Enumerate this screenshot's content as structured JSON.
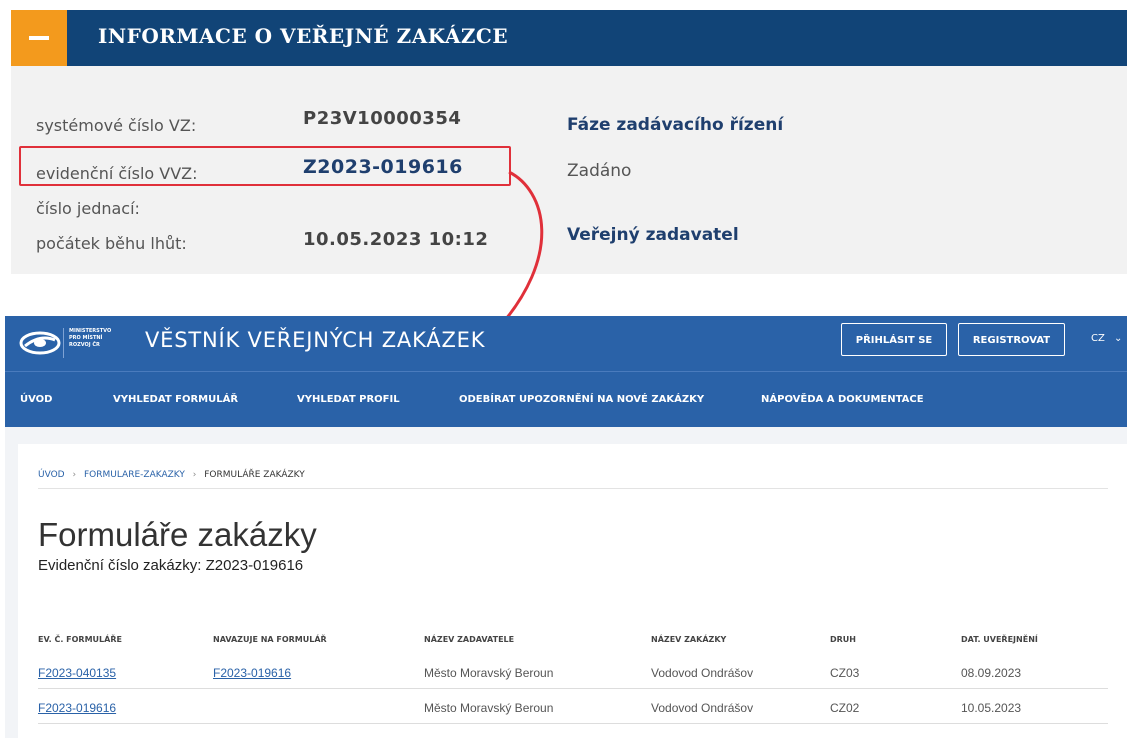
{
  "info_panel": {
    "title": "INFORMACE O VEŘEJNÉ ZAKÁZCE",
    "collapse_symbol": "minus-icon",
    "fields": [
      {
        "label": "systémové číslo VZ:",
        "value": "P23V10000354"
      },
      {
        "label": "evidenční číslo VVZ:",
        "value": "Z2023-019616"
      },
      {
        "label": "číslo jednací:",
        "value": ""
      },
      {
        "label": "počátek běhu lhůt:",
        "value": "10.05.2023 10:12"
      }
    ],
    "phase_heading": "Fáze zadávacího řízení",
    "phase_value": "Zadáno",
    "contracting_heading": "Veřejný zadavatel"
  },
  "vestnik": {
    "ministry_lines": [
      "MINISTERSTVO",
      "PRO MÍSTNÍ",
      "ROZVOJ ČR"
    ],
    "title": "VĚSTNÍK VEŘEJNÝCH ZAKÁZEK",
    "login_label": "PŘIHLÁSIT SE",
    "register_label": "REGISTROVAT",
    "lang_label": "CZ",
    "nav": [
      "ÚVOD",
      "VYHLEDAT FORMULÁŘ",
      "VYHLEDAT PROFIL",
      "ODEBÍRAT UPOZORNĚNÍ NA NOVÉ ZAKÁZKY",
      "NÁPOVĚDA A DOKUMENTACE"
    ],
    "breadcrumb": [
      "ÚVOD",
      "FORMULARE-ZAKAZKY",
      "FORMULÁŘE ZAKÁZKY"
    ],
    "page_title": "Formuláře zakázky",
    "page_subtitle": "Evidenční číslo zakázky: Z2023-019616",
    "table": {
      "headers": [
        "EV. Č. FORMULÁŘE",
        "NAVAZUJE NA FORMULÁŘ",
        "NÁZEV ZADAVATELE",
        "NÁZEV ZAKÁZKY",
        "DRUH",
        "DAT. UVEŘEJNĚNÍ"
      ],
      "rows": [
        [
          "F2023-040135",
          "F2023-019616",
          "Město Moravský Beroun",
          "Vodovod Ondrášov",
          "CZ03",
          "08.09.2023"
        ],
        [
          "F2023-019616",
          "",
          "Město Moravský Beroun",
          "Vodovod Ondrášov",
          "CZ02",
          "10.05.2023"
        ]
      ]
    }
  },
  "colors": {
    "panel_header": "#114477",
    "accent_orange": "#f39a1d",
    "vestnik_blue": "#2a62a8",
    "callout_red": "#e0303a"
  }
}
